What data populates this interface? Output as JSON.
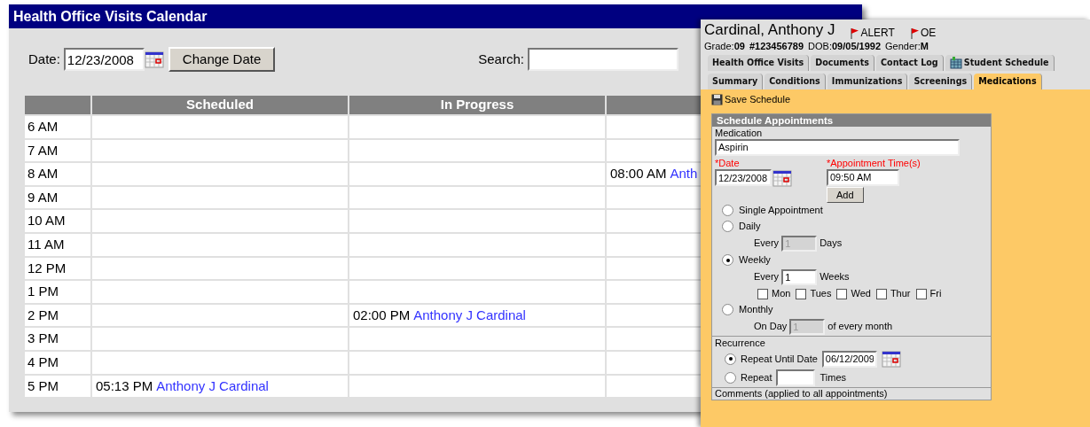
{
  "calendar": {
    "title": "Health Office Visits Calendar",
    "date_label": "Date:",
    "date_value": "12/23/2008",
    "change_date_button": "Change Date",
    "search_label": "Search:",
    "columns": [
      {
        "label": "Scheduled"
      },
      {
        "label": "In Progress"
      }
    ],
    "rows": [
      {
        "time": "6 AM"
      },
      {
        "time": "7 AM"
      },
      {
        "time": "8 AM",
        "column_3": {
          "time": "08:00 AM",
          "name": "Anth"
        }
      },
      {
        "time": "9 AM"
      },
      {
        "time": "10 AM"
      },
      {
        "time": "11 AM"
      },
      {
        "time": "12 PM"
      },
      {
        "time": "1 PM"
      },
      {
        "time": "2 PM",
        "in_progress": {
          "time": "02:00 PM",
          "name": "Anthony J Cardinal"
        }
      },
      {
        "time": "3 PM"
      },
      {
        "time": "4 PM"
      },
      {
        "time": "5 PM",
        "scheduled": {
          "time": "05:13 PM",
          "name": "Anthony J Cardinal"
        }
      }
    ]
  },
  "student": {
    "name": "Cardinal, Anthony J",
    "flags": [
      {
        "label": "ALERT"
      },
      {
        "label": "OE"
      }
    ],
    "info": [
      {
        "label": "Grade:",
        "value": "09"
      },
      {
        "value": "#123456789"
      },
      {
        "label": "DOB:",
        "value": "09/05/1992"
      },
      {
        "label": "Gender:",
        "value": "M"
      }
    ],
    "tab_rows": [
      {
        "tabs": [
          {
            "label": "Health Office Visits",
            "selected": false,
            "icon": false
          },
          {
            "label": "Documents",
            "selected": false,
            "icon": false
          },
          {
            "label": "Contact Log",
            "selected": false,
            "icon": false
          },
          {
            "label": "Student Schedule",
            "selected": false,
            "icon": true
          }
        ]
      },
      {
        "tabs": [
          {
            "label": "Summary",
            "selected": false,
            "icon": false
          },
          {
            "label": "Conditions",
            "selected": false,
            "icon": false
          },
          {
            "label": "Immunizations",
            "selected": false,
            "icon": false
          },
          {
            "label": "Screenings",
            "selected": false,
            "icon": false
          },
          {
            "label": "Medications",
            "selected": true,
            "icon": false
          }
        ]
      }
    ],
    "save_button": "Save Schedule",
    "form": {
      "title": "Schedule Appointments",
      "medication_label": "Medication",
      "medication_value": "Aspirin",
      "date_label": "*Date",
      "date_value": "12/23/2008",
      "time_label": "*Appointment Time(s)",
      "time_value": "09:50 AM",
      "add_button": "Add",
      "frequency": [
        {
          "label": "Single Appointment",
          "selected": false
        },
        {
          "label": "Daily",
          "selected": false,
          "detail": {
            "prefix": "Every",
            "value": "1",
            "suffix": "Days",
            "disabled": true
          }
        },
        {
          "label": "Weekly",
          "selected": true,
          "detail": {
            "prefix": "Every",
            "value": "1",
            "suffix": "Weeks",
            "disabled": false
          },
          "days": [
            {
              "label": "Mon",
              "checked": false
            },
            {
              "label": "Tues",
              "checked": false
            },
            {
              "label": "Wed",
              "checked": false
            },
            {
              "label": "Thur",
              "checked": false
            },
            {
              "label": "Fri",
              "checked": false
            }
          ]
        },
        {
          "label": "Monthly",
          "selected": false,
          "detail": {
            "prefix": "On Day",
            "value": "1",
            "suffix": "of every month",
            "disabled": true
          }
        }
      ],
      "recurrence_label": "Recurrence",
      "recurrence": [
        {
          "label": "Repeat Until Date",
          "selected": true,
          "value": "06/12/2009",
          "calendar": true
        },
        {
          "label": "Repeat",
          "selected": false,
          "suffix": "Times",
          "calendar": false
        }
      ],
      "comments_label": "Comments (applied to all appointments)"
    }
  }
}
